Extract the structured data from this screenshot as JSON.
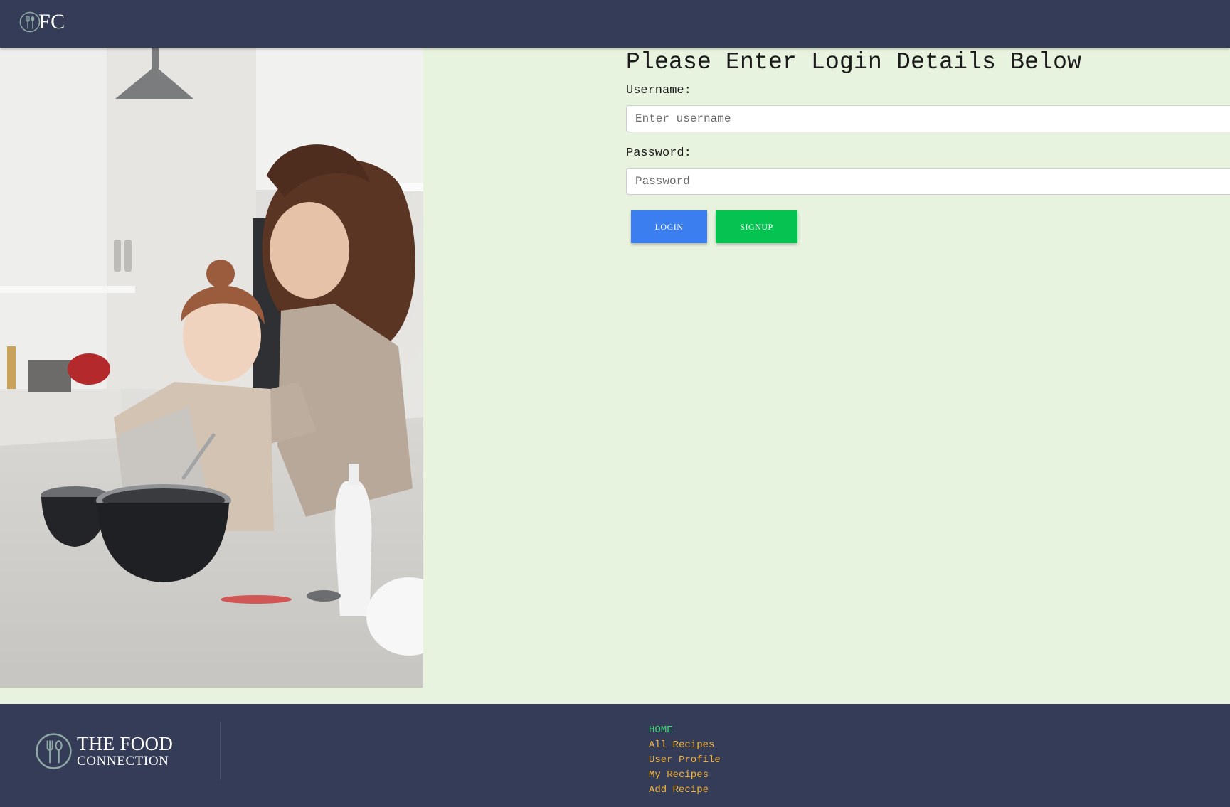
{
  "header": {
    "brand_text": "FC",
    "logo_icon": "fork-spoon-icon"
  },
  "hero_image": {
    "icon": "kitchen-photo",
    "accent_colors": [
      "#ffffff",
      "#f0efed",
      "#2b2d33",
      "#b7a89a",
      "#5a3524"
    ]
  },
  "login_form": {
    "heading": "Please Enter Login Details Below",
    "username_label": "Username:",
    "username_placeholder": "Enter username",
    "password_label": "Password:",
    "password_placeholder": "Password",
    "login_label": "LOGIN",
    "signup_label": "SIGNUP",
    "login_color": "#3b7ef0",
    "signup_color": "#04c350"
  },
  "footer": {
    "logo_line1": "THE FOOD",
    "logo_line2": "CONNECTION",
    "nav": [
      {
        "label": "HOME",
        "active": true
      },
      {
        "label": "All Recipes",
        "active": false
      },
      {
        "label": "User Profile",
        "active": false
      },
      {
        "label": "My Recipes",
        "active": false
      },
      {
        "label": "Add Recipe",
        "active": false
      }
    ],
    "active_color": "#3fd675",
    "link_color": "#f2b43a"
  },
  "theme": {
    "nav_bg": "#353c57",
    "page_bg": "#e8f3df"
  }
}
